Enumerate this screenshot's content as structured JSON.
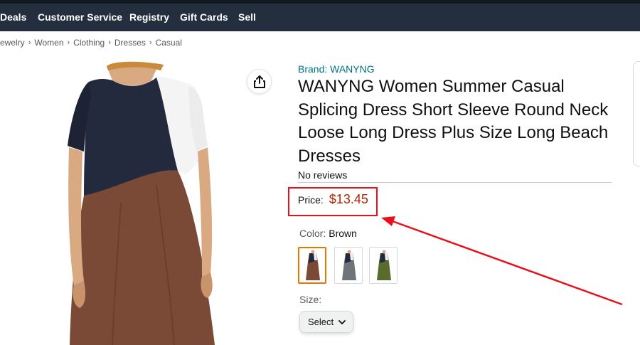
{
  "nav": {
    "links": [
      "Deals",
      "Customer Service",
      "Registry",
      "Gift Cards",
      "Sell"
    ]
  },
  "breadcrumb": {
    "items": [
      "ewelry",
      "Women",
      "Clothing",
      "Dresses",
      "Casual"
    ],
    "separator": "›"
  },
  "product": {
    "brand_link": "Brand: WANYNG",
    "title": "WANYNG Women Summer Casual Splicing Dress Short Sleeve Round Neck Loose Long Dress Plus Size Long Beach Dresses",
    "reviews": "No reviews",
    "price_label": "Price:",
    "price_value": "$13.45",
    "color_label": "Color:",
    "color_value": "Brown",
    "swatches": [
      "brown",
      "gray",
      "green"
    ],
    "size_label": "Size:",
    "size_select": "Select"
  },
  "icons": {
    "share": "share-icon",
    "chevron": "chevron-down-icon"
  },
  "colors": {
    "nav_bg": "#232f3e",
    "price": "#b12704",
    "link": "#007185",
    "annotation": "#e8101a",
    "swatch_selected": "#e77600"
  }
}
